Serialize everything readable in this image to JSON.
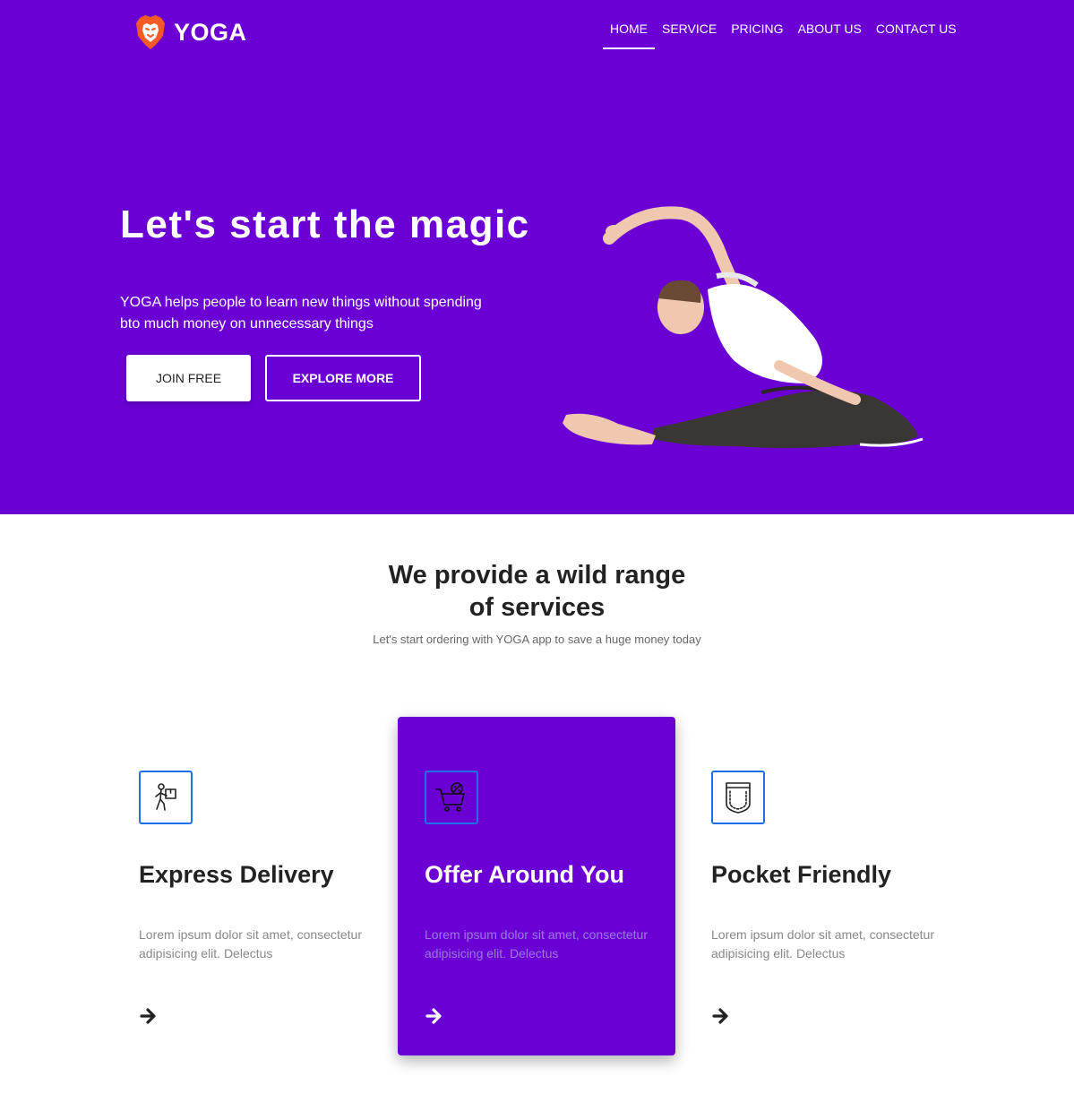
{
  "brand": {
    "name": "YOGA"
  },
  "nav": {
    "items": [
      {
        "label": "HOME",
        "active": true
      },
      {
        "label": "SERVICE",
        "active": false
      },
      {
        "label": "PRICING",
        "active": false
      },
      {
        "label": "ABOUT US",
        "active": false
      },
      {
        "label": "CONTACT US",
        "active": false
      }
    ]
  },
  "hero": {
    "title": "Let's start the magic",
    "subtitle": "YOGA helps people to learn new things without spending bto much money on unnecessary things",
    "join_label": "JOIN FREE",
    "explore_label": "EXPLORE MORE"
  },
  "services": {
    "title_line1": "We provide a wild range",
    "title_line2": "of services",
    "subtitle": "Let's start ordering with YOGA app to save a huge money today",
    "items": [
      {
        "icon": "delivery-person-icon",
        "title": "Express Delivery",
        "desc": "Lorem ipsum dolor sit amet, consectetur adipisicing elit. Delectus"
      },
      {
        "icon": "shopping-cart-discount-icon",
        "title": "Offer Around You",
        "desc": "Lorem ipsum dolor sit amet, consectetur adipisicing elit. Delectus"
      },
      {
        "icon": "pocket-icon",
        "title": "Pocket Friendly",
        "desc": "Lorem ipsum dolor sit amet, consectetur adipisicing elit. Delectus"
      }
    ]
  },
  "colors": {
    "primary_purple": "#6a00d4",
    "icon_border_blue": "#1f6fe6",
    "logo_orange": "#f15a24",
    "text_dark": "#222222"
  }
}
